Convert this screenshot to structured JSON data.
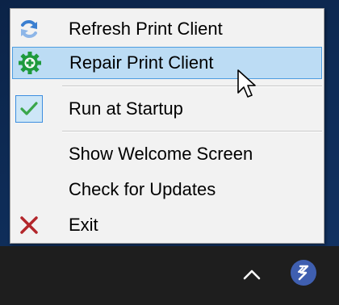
{
  "menu": {
    "items": [
      {
        "label": "Refresh Print Client",
        "icon": "refresh-icon"
      },
      {
        "label": "Repair Print Client",
        "icon": "gear-icon",
        "highlighted": true
      },
      {
        "label": "Run at Startup",
        "icon": "checkmark-icon",
        "checked": true
      },
      {
        "label": "Show Welcome Screen",
        "icon": ""
      },
      {
        "label": "Check for Updates",
        "icon": ""
      },
      {
        "label": "Exit",
        "icon": "close-x-icon"
      }
    ]
  },
  "taskbar": {
    "tray_icons": [
      "chevron-up-icon",
      "print-client-icon"
    ]
  },
  "colors": {
    "menu_bg": "#f2f2f2",
    "highlight_bg": "#bcdcf4",
    "highlight_border": "#4d9de0",
    "gear_green": "#1e9a3c",
    "check_green": "#3aa64a",
    "exit_red": "#b3262b",
    "refresh_blue": "#3b7fd0"
  }
}
